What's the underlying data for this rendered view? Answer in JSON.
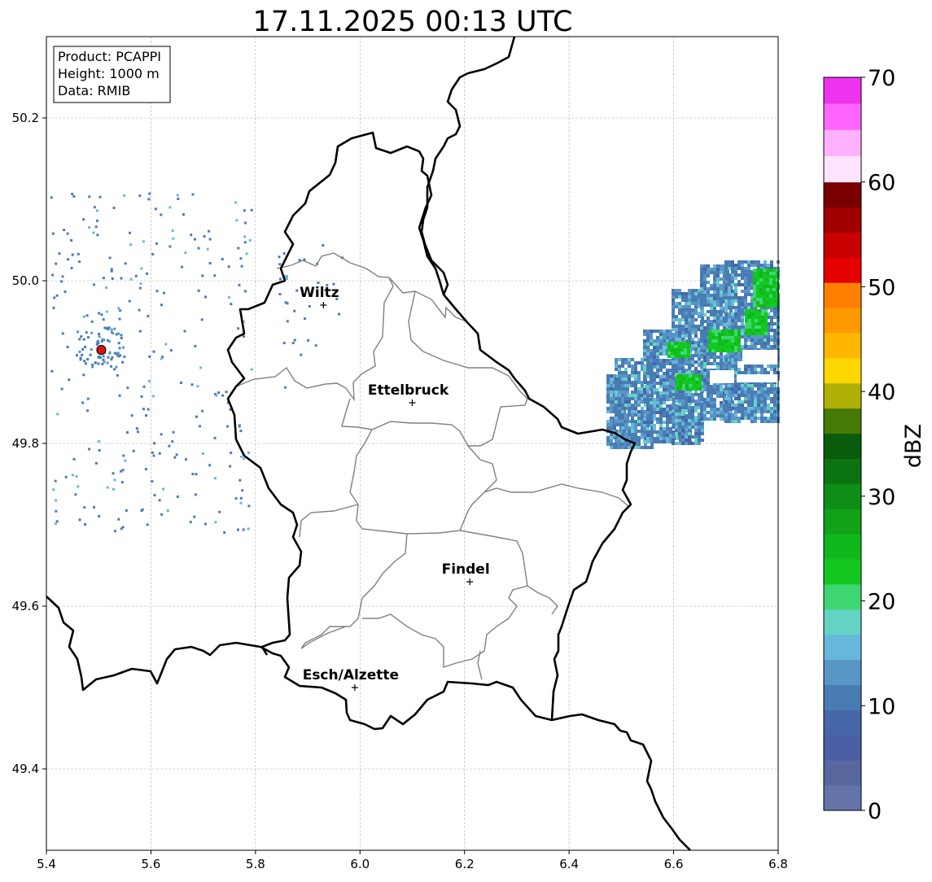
{
  "title": "17.11.2025 00:13 UTC",
  "info": {
    "product": "Product: PCAPPI",
    "height": "Height: 1000 m",
    "source": "Data: RMIB"
  },
  "axes": {
    "x_range": [
      5.4,
      6.8
    ],
    "y_range": [
      49.3,
      50.3
    ],
    "x_ticks": [
      "5.4",
      "5.6",
      "5.8",
      "6.0",
      "6.2",
      "6.4",
      "6.6",
      "6.8"
    ],
    "y_ticks": [
      "49.4",
      "49.6",
      "49.8",
      "50.0",
      "50.2"
    ],
    "grid": true
  },
  "cities": [
    {
      "name": "Wiltz",
      "lon": 5.93,
      "lat": 49.97
    },
    {
      "name": "Ettelbruck",
      "lon": 6.1,
      "lat": 49.85
    },
    {
      "name": "Findel",
      "lon": 6.21,
      "lat": 49.63
    },
    {
      "name": "Esch/Alzette",
      "lon": 5.99,
      "lat": 49.5
    }
  ],
  "radar_site": {
    "lon": 5.505,
    "lat": 49.915,
    "color": "#dd1111"
  },
  "colorbar": {
    "label": "dBZ",
    "min": 0,
    "max": 70,
    "tick_labels": [
      "0",
      "10",
      "20",
      "30",
      "40",
      "50",
      "60",
      "70"
    ],
    "colors": [
      "#6574a8",
      "#58689f",
      "#4c5fa4",
      "#4668aa",
      "#4a7cb4",
      "#5896c6",
      "#67b8da",
      "#63d4c3",
      "#3ed673",
      "#12c81f",
      "#11b81b",
      "#11a218",
      "#0e8d17",
      "#0b7312",
      "#085c0c",
      "#457a04",
      "#aeb104",
      "#ffd700",
      "#ffb700",
      "#ff9900",
      "#ff7f00",
      "#e60000",
      "#c80000",
      "#a00000",
      "#780000",
      "#ffe4ff",
      "#ffb0ff",
      "#ff66ff",
      "#ee33ee"
    ]
  }
}
